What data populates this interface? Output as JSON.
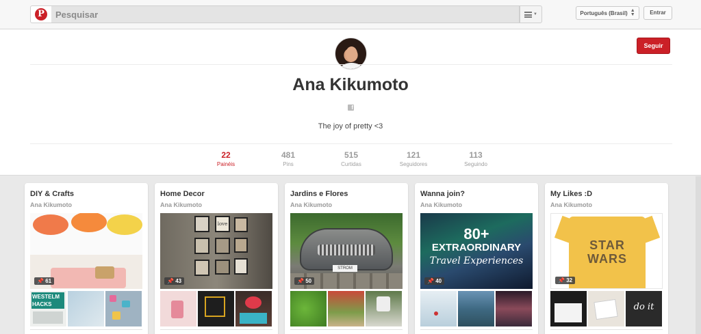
{
  "header": {
    "logo_letter": "P",
    "search_placeholder": "Pesquisar",
    "language_label": "Português (Brasil)",
    "login_label": "Entrar"
  },
  "profile": {
    "name": "Ana Kikumoto",
    "bio": "The joy of pretty <3",
    "follow_label": "Seguir",
    "facebook_icon_letter": "f",
    "stats": [
      {
        "value": "22",
        "label": "Painéis",
        "active": true
      },
      {
        "value": "481",
        "label": "Pins",
        "active": false
      },
      {
        "value": "515",
        "label": "Curtidas",
        "active": false
      },
      {
        "value": "121",
        "label": "Seguidores",
        "active": false
      },
      {
        "value": "113",
        "label": "Seguindo",
        "active": false
      }
    ]
  },
  "boards": [
    {
      "title": "DIY & Crafts",
      "owner": "Ana Kikumoto",
      "pins": "61",
      "thumb_text": "WESTELM HACKS"
    },
    {
      "title": "Home Decor",
      "owner": "Ana Kikumoto",
      "pins": "43",
      "cover_text": "love"
    },
    {
      "title": "Jardins e Flores",
      "owner": "Ana Kikumoto",
      "pins": "50",
      "cover_text": "STROM"
    },
    {
      "title": "Wanna join?",
      "owner": "Ana Kikumoto",
      "pins": "40",
      "cover_text_1": "80+",
      "cover_text_2": "EXTRAORDINARY",
      "cover_text_3": "Travel Experiences"
    },
    {
      "title": "My Likes :D",
      "owner": "Ana Kikumoto",
      "pins": "32",
      "cover_text_1": "STAR",
      "cover_text_2": "WARS",
      "thumb_text": "do it"
    }
  ],
  "colors": {
    "brand_red": "#cb2027",
    "background": "#e9e9e9"
  }
}
